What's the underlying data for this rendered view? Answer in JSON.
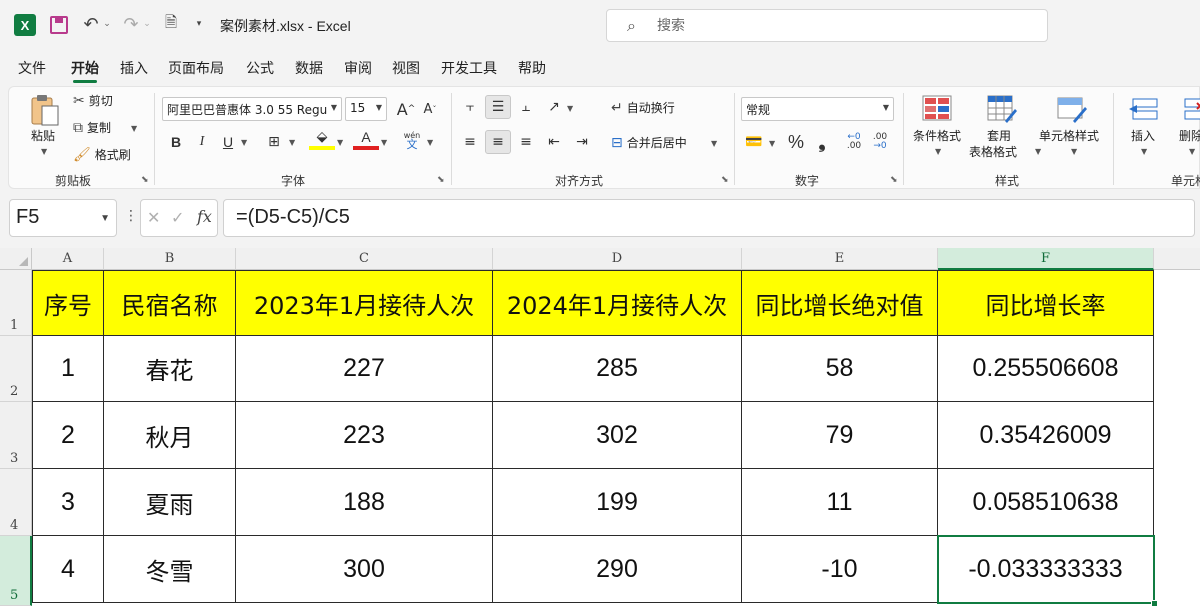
{
  "titlebar": {
    "doc_title": "案例素材.xlsx  -  Excel",
    "logo_text": "X",
    "search_placeholder": "搜索"
  },
  "tabs": [
    {
      "label": "文件"
    },
    {
      "label": "开始"
    },
    {
      "label": "插入"
    },
    {
      "label": "页面布局"
    },
    {
      "label": "公式"
    },
    {
      "label": "数据"
    },
    {
      "label": "审阅"
    },
    {
      "label": "视图"
    },
    {
      "label": "开发工具"
    },
    {
      "label": "帮助"
    }
  ],
  "ribbon": {
    "clipboard": {
      "paste": "粘贴",
      "cut": "剪切",
      "copy": "复制",
      "format_painter": "格式刷",
      "label": "剪贴板"
    },
    "font": {
      "font_name": "阿里巴巴普惠体 3.0 55 Regu",
      "font_size": "15",
      "bold": "B",
      "italic": "I",
      "underline": "U",
      "label": "字体",
      "phonetic_top": "wén",
      "phonetic_bottom": "文"
    },
    "alignment": {
      "wrap_text": "自动换行",
      "merge_center": "合并后居中",
      "label": "对齐方式"
    },
    "number": {
      "format": "常规",
      "percent": "%",
      "comma": "❟",
      "inc_decimal": ".00",
      "dec_decimal": ".00",
      "label": "数字"
    },
    "styles": {
      "conditional": "条件格式",
      "table_format_1": "套用",
      "table_format_2": "表格格式",
      "cell_styles": "单元格样式",
      "label": "样式"
    },
    "cells": {
      "insert": "插入",
      "delete": "删除",
      "label": "单元格"
    }
  },
  "formula_bar": {
    "name_box": "F5",
    "formula": "=(D5-C5)/C5",
    "fx": "fx"
  },
  "sheet": {
    "columns": [
      "A",
      "B",
      "C",
      "D",
      "E",
      "F"
    ],
    "row_numbers": [
      "1",
      "2",
      "3",
      "4",
      "5"
    ],
    "header": [
      "序号",
      "民宿名称",
      "2023年1月接待人次",
      "2024年1月接待人次",
      "同比增长绝对值",
      "同比增长率"
    ],
    "rows": [
      [
        "1",
        "春花",
        "227",
        "285",
        "58",
        "0.255506608"
      ],
      [
        "2",
        "秋月",
        "223",
        "302",
        "79",
        "0.35426009"
      ],
      [
        "3",
        "夏雨",
        "188",
        "199",
        "11",
        "0.058510638"
      ],
      [
        "4",
        "冬雪",
        "300",
        "290",
        "-10",
        "-0.033333333"
      ]
    ],
    "header_fill": "#ffff00",
    "accent": "#107c41"
  }
}
